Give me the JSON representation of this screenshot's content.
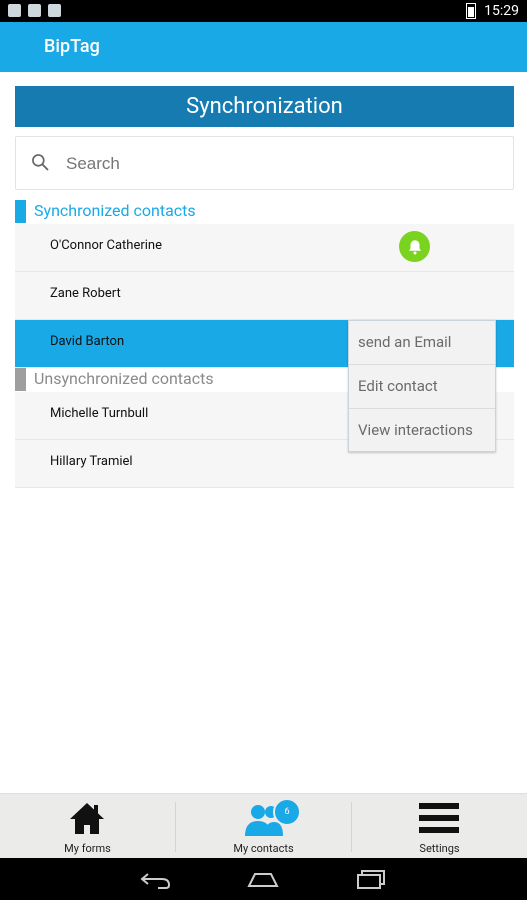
{
  "status_bar": {
    "time": "15:29"
  },
  "app_bar": {
    "title": "BipTag"
  },
  "page_title": "Synchronization",
  "search": {
    "placeholder": "Search",
    "value": ""
  },
  "synchronized": {
    "header": "Synchronized contacts",
    "accent_color": "#19a9e6",
    "contacts": [
      {
        "name": "O'Connor Catherine"
      },
      {
        "name": "Zane Robert"
      },
      {
        "name": "David Barton"
      }
    ]
  },
  "unsynchronized": {
    "header": "Unsynchronized contacts",
    "accent_color": "#9e9e9e",
    "contacts": [
      {
        "name": "Michelle Turnbull"
      },
      {
        "name": "Hillary Tramiel"
      }
    ]
  },
  "context_menu": {
    "items": [
      "send an Email",
      "Edit contact",
      "View interactions"
    ]
  },
  "bottom_nav": {
    "tabs": [
      {
        "label": "My forms",
        "icon": "house-icon"
      },
      {
        "label": "My contacts",
        "icon": "contacts-icon",
        "badge": "6"
      },
      {
        "label": "Settings",
        "icon": "menu-icon"
      }
    ]
  },
  "colors": {
    "primary": "#19a9e6",
    "header_dark": "#157bb1",
    "notify_green": "#7ad31f"
  }
}
